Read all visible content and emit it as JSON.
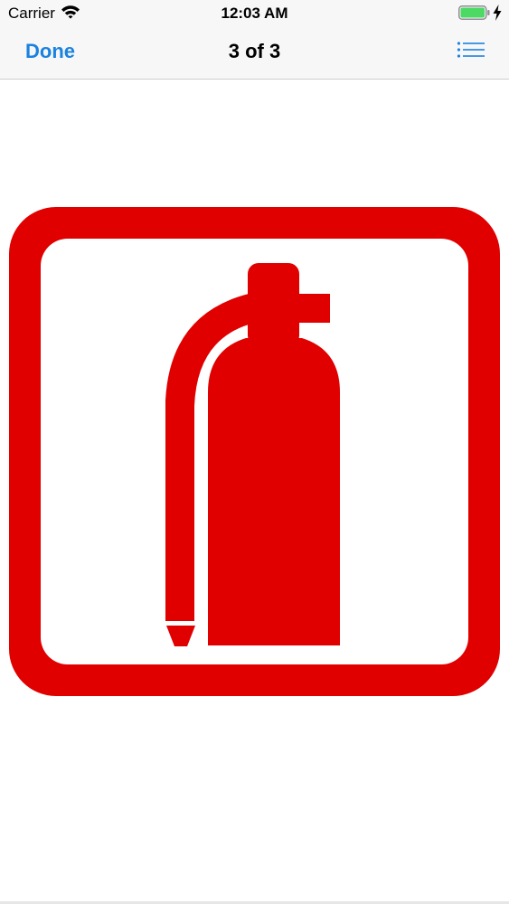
{
  "status_bar": {
    "carrier": "Carrier",
    "time": "12:03 AM",
    "wifi_icon": "wifi-icon",
    "battery_icon": "battery-full-icon",
    "charging_icon": "charging-bolt-icon"
  },
  "nav": {
    "done_label": "Done",
    "title": "3 of 3",
    "list_icon": "list-icon",
    "accent_color": "#1a82e0"
  },
  "image": {
    "subject_icon": "fire-extinguisher-sign",
    "sign_color": "#e00000"
  }
}
